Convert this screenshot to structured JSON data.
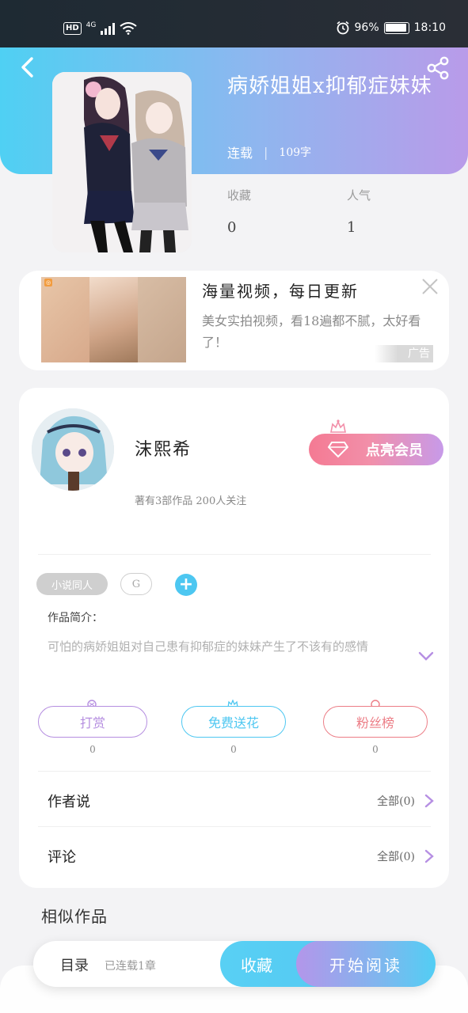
{
  "status_bar": {
    "network_hd": "HD",
    "network_type": "4G",
    "battery_percent": "96%",
    "battery_level": 0.96,
    "time": "18:10",
    "icons": [
      "hd-icon",
      "signal-icon",
      "wifi-icon",
      "alarm-icon",
      "battery-icon"
    ]
  },
  "header": {
    "back_icon": "back-arrow-icon",
    "share_icon": "share-icon",
    "title": "病娇姐姐x抑郁症妹妹",
    "status": "连载",
    "word_count": "109字",
    "stats": {
      "favorites_label": "收藏",
      "favorites_value": "0",
      "popularity_label": "人气",
      "popularity_value": "1"
    }
  },
  "ad": {
    "title": "海量视频，每日更新",
    "description": "美女实拍视频，看18遍都不腻，太好看了！",
    "tag": "广告",
    "close_icon": "close-icon"
  },
  "author": {
    "name": "沫熙希",
    "subtitle": "著有3部作品 200人关注",
    "vip_button": "点亮会员"
  },
  "tags": [
    "小说同人",
    "G"
  ],
  "intro": {
    "label": "作品简介：",
    "text": "可怕的病娇姐姐对自己患有抑郁症的妹妹产生了不该有的感情"
  },
  "actions": [
    {
      "label": "打赏",
      "count": "0",
      "color": "#b58ee0"
    },
    {
      "label": "免费送花",
      "count": "0",
      "color": "#4dc7f1"
    },
    {
      "label": "粉丝榜",
      "count": "0",
      "color": "#ec7d86"
    }
  ],
  "sections": {
    "author_says": {
      "title": "作者说",
      "all": "全部(0)"
    },
    "comments": {
      "title": "评论",
      "all": "全部(0)"
    }
  },
  "similar_title": "相似作品",
  "bottom_bar": {
    "toc_label": "目录",
    "toc_sub": "已连载1章",
    "favorite_button": "收藏",
    "read_button": "开始阅读"
  },
  "colors": {
    "accent_blue": "#4fd0f3",
    "accent_purple": "#b99be9",
    "vip_pink": "#f47a93"
  }
}
